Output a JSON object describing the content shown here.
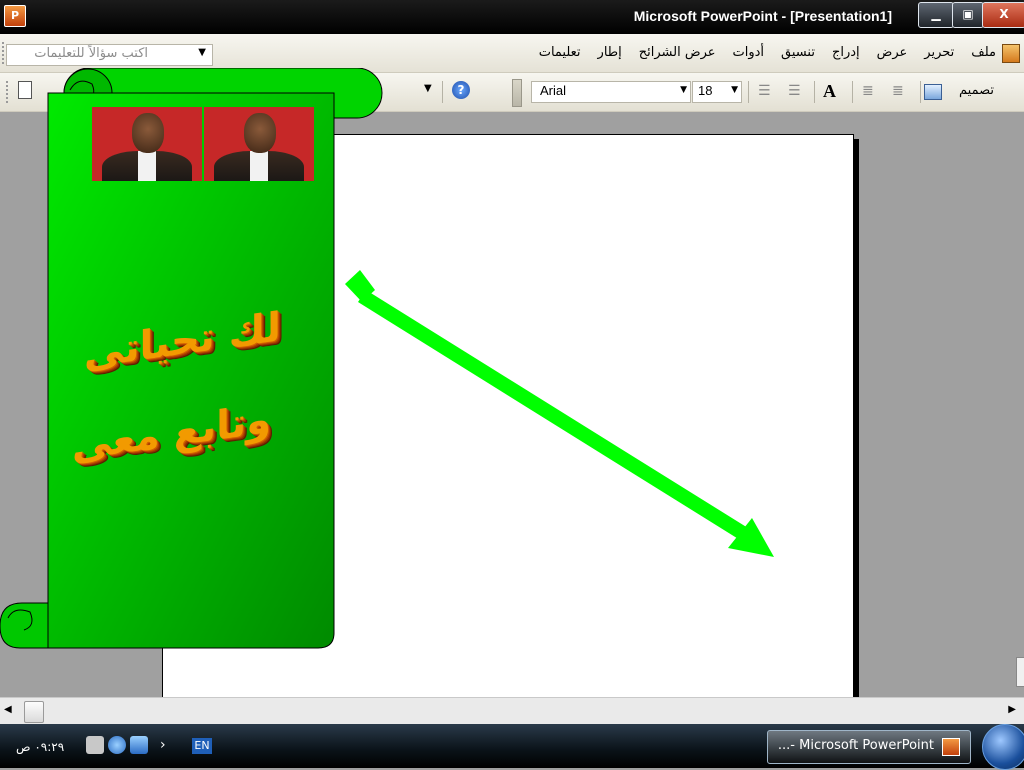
{
  "window": {
    "title": "Microsoft PowerPoint - [Presentation1]",
    "app_icon": "P",
    "minimize": "▁",
    "maximize": "▣",
    "close": "X"
  },
  "menu": {
    "help_placeholder": "اكتب سؤالاً للتعليمات",
    "items": [
      "ملف",
      "تحرير",
      "عرض",
      "إدراج",
      "تنسيق",
      "أدوات",
      "عرض الشرائح",
      "إطار",
      "تعليمات"
    ]
  },
  "toolbar": {
    "font_name": "Arial",
    "font_size": "18",
    "design_label": "تصميم",
    "help_symbol": "?",
    "grow_font": "A"
  },
  "wordart": {
    "line1": "لك تحياتى",
    "line2": "وتابع معى"
  },
  "taskbar": {
    "clock": "٠٩:٢٩ ص",
    "language": "EN",
    "task_label": "...- Microsoft PowerPoint"
  },
  "colors": {
    "scroll_green": "#00c800",
    "arrow_green": "#00ff00",
    "wordart_orange": "#f29a00"
  }
}
